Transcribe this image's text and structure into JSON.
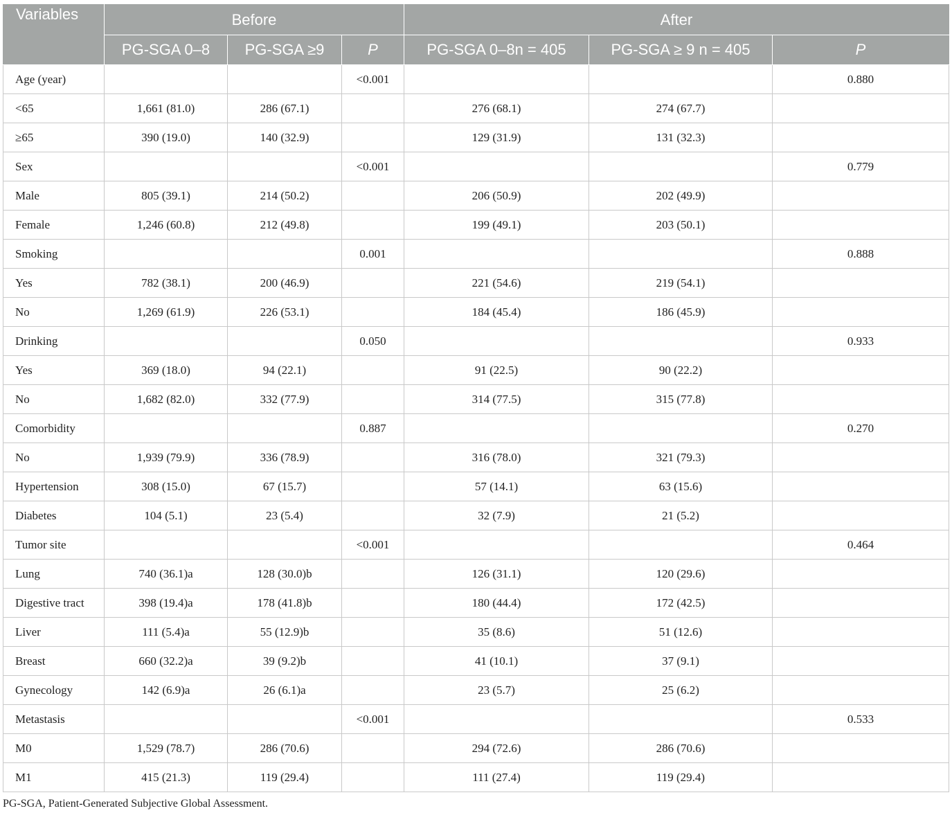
{
  "table": {
    "header": {
      "variables": "Variables",
      "before": "Before",
      "after": "After",
      "sub": {
        "before_low": "PG-SGA 0–8",
        "before_high": "PG-SGA ≥9",
        "before_p": "P",
        "after_low": "PG-SGA 0–8n = 405",
        "after_high": "PG-SGA ≥ 9 n = 405",
        "after_p": "P"
      }
    },
    "rows": [
      [
        "Age (year)",
        "",
        "",
        "<0.001",
        "",
        "",
        "0.880"
      ],
      [
        "<65",
        "1,661 (81.0)",
        "286 (67.1)",
        "",
        "276 (68.1)",
        "274 (67.7)",
        ""
      ],
      [
        "≥65",
        "390 (19.0)",
        "140 (32.9)",
        "",
        "129 (31.9)",
        "131 (32.3)",
        ""
      ],
      [
        "Sex",
        "",
        "",
        "<0.001",
        "",
        "",
        "0.779"
      ],
      [
        "Male",
        "805 (39.1)",
        "214 (50.2)",
        "",
        "206 (50.9)",
        "202 (49.9)",
        ""
      ],
      [
        "Female",
        "1,246 (60.8)",
        "212 (49.8)",
        "",
        "199 (49.1)",
        "203 (50.1)",
        ""
      ],
      [
        "Smoking",
        "",
        "",
        "0.001",
        "",
        "",
        "0.888"
      ],
      [
        "Yes",
        "782 (38.1)",
        "200 (46.9)",
        "",
        "221 (54.6)",
        "219 (54.1)",
        ""
      ],
      [
        "No",
        "1,269 (61.9)",
        "226 (53.1)",
        "",
        "184 (45.4)",
        "186 (45.9)",
        ""
      ],
      [
        "Drinking",
        "",
        "",
        "0.050",
        "",
        "",
        "0.933"
      ],
      [
        "Yes",
        "369 (18.0)",
        "94 (22.1)",
        "",
        "91 (22.5)",
        "90 (22.2)",
        ""
      ],
      [
        "No",
        "1,682 (82.0)",
        "332 (77.9)",
        "",
        "314 (77.5)",
        "315 (77.8)",
        ""
      ],
      [
        "Comorbidity",
        "",
        "",
        "0.887",
        "",
        "",
        "0.270"
      ],
      [
        "No",
        "1,939 (79.9)",
        "336 (78.9)",
        "",
        "316 (78.0)",
        "321 (79.3)",
        ""
      ],
      [
        "Hypertension",
        "308 (15.0)",
        "67 (15.7)",
        "",
        "57 (14.1)",
        "63 (15.6)",
        ""
      ],
      [
        "Diabetes",
        "104 (5.1)",
        "23 (5.4)",
        "",
        "32 (7.9)",
        "21 (5.2)",
        ""
      ],
      [
        "Tumor site",
        "",
        "",
        "<0.001",
        "",
        "",
        "0.464"
      ],
      [
        "Lung",
        "740 (36.1)a",
        "128 (30.0)b",
        "",
        "126 (31.1)",
        "120 (29.6)",
        ""
      ],
      [
        "Digestive tract",
        "398 (19.4)a",
        "178 (41.8)b",
        "",
        "180 (44.4)",
        "172 (42.5)",
        ""
      ],
      [
        "Liver",
        "111 (5.4)a",
        "55 (12.9)b",
        "",
        "35 (8.6)",
        "51 (12.6)",
        ""
      ],
      [
        "Breast",
        "660 (32.2)a",
        "39 (9.2)b",
        "",
        "41 (10.1)",
        "37 (9.1)",
        ""
      ],
      [
        "Gynecology",
        "142 (6.9)a",
        "26 (6.1)a",
        "",
        "23 (5.7)",
        "25 (6.2)",
        ""
      ],
      [
        "Metastasis",
        "",
        "",
        "<0.001",
        "",
        "",
        "0.533"
      ],
      [
        "M0",
        "1,529 (78.7)",
        "286 (70.6)",
        "",
        "294 (72.6)",
        "286 (70.6)",
        ""
      ],
      [
        "M1",
        "415 (21.3)",
        "119 (29.4)",
        "",
        "111 (27.4)",
        "119 (29.4)",
        ""
      ]
    ]
  },
  "footnote": "PG-SGA, Patient-Generated Subjective Global Assessment."
}
